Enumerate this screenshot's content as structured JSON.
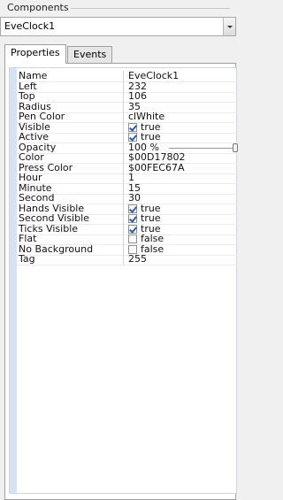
{
  "panel": {
    "title": "Components",
    "selected_component": "EveClock1"
  },
  "tabs": [
    {
      "label": "Properties",
      "active": true
    },
    {
      "label": "Events",
      "active": false
    }
  ],
  "properties": [
    {
      "name": "Name",
      "value": "EveClock1"
    },
    {
      "name": "Left",
      "value": "232"
    },
    {
      "name": "Top",
      "value": "106"
    },
    {
      "name": "Radius",
      "value": "35"
    },
    {
      "name": "Pen Color",
      "value": "clWhite"
    },
    {
      "name": "Visible",
      "value": "true",
      "checkbox": true,
      "checked": true
    },
    {
      "name": "Active",
      "value": "true",
      "checkbox": true,
      "checked": true
    },
    {
      "name": "Opacity",
      "value": "100 %",
      "slider": true,
      "level": 1.0
    },
    {
      "name": "Color",
      "value": "$00D17802"
    },
    {
      "name": "Press Color",
      "value": "$00FEC67A"
    },
    {
      "name": "Hour",
      "value": "1"
    },
    {
      "name": "Minute",
      "value": "15"
    },
    {
      "name": "Second",
      "value": "30"
    },
    {
      "name": "Hands Visible",
      "value": "true",
      "checkbox": true,
      "checked": true
    },
    {
      "name": "Second Visible",
      "value": "true",
      "checkbox": true,
      "checked": true
    },
    {
      "name": "Ticks Visible",
      "value": "true",
      "checkbox": true,
      "checked": true
    },
    {
      "name": "Flat",
      "value": "false",
      "checkbox": true,
      "checked": false
    },
    {
      "name": "No Background",
      "value": "false",
      "checkbox": true,
      "checked": false
    },
    {
      "name": "Tag",
      "value": "255"
    }
  ],
  "icons": {
    "combo_dropdown": "chevron-down-icon",
    "checkbox": "checkbox-icon"
  },
  "colors": {
    "gutter": "#d7e3f3",
    "checkmark": "#2b5aa8"
  }
}
